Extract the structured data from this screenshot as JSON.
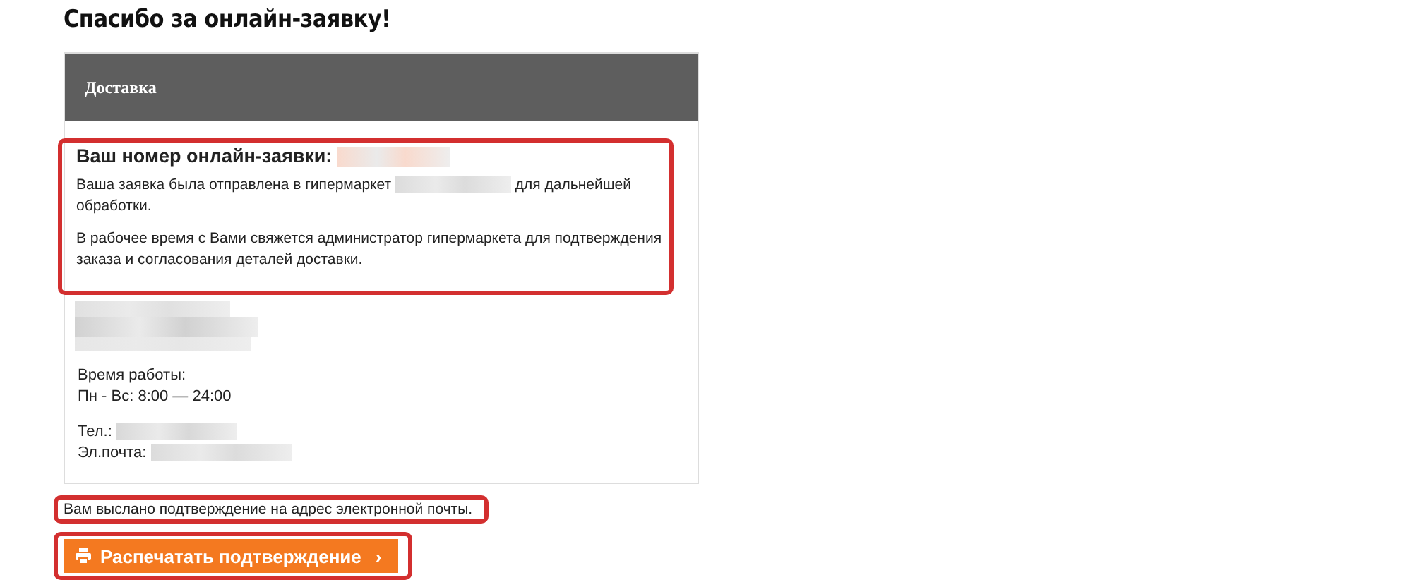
{
  "page_title": "Спасибо за онлайн-заявку!",
  "card": {
    "tab": "Доставка",
    "order_block": {
      "highlighted": true,
      "title": "Ваш номер онлайн-заявки:",
      "paragraphs": [
        {
          "before": "Ваша заявка была отправлена в гипермаркет",
          "after": "для дальнейшей обработки."
        },
        {
          "before": "В рабочее время с Вами свяжется администратор гипермаркета для подтверждения заказа и согласования деталей доставки."
        }
      ]
    },
    "hours_label": "Время работы:",
    "hours": "Пн - Вс: 8:00 — 24:00",
    "phone_label": "Тел.:",
    "email_label": "Эл.почта:"
  },
  "note": {
    "highlighted": true,
    "text": "Вам выслано подтверждение на адрес электронной почты."
  },
  "print_button": {
    "highlighted": true,
    "label": "Распечатать подтверждение",
    "chevron": "›"
  }
}
